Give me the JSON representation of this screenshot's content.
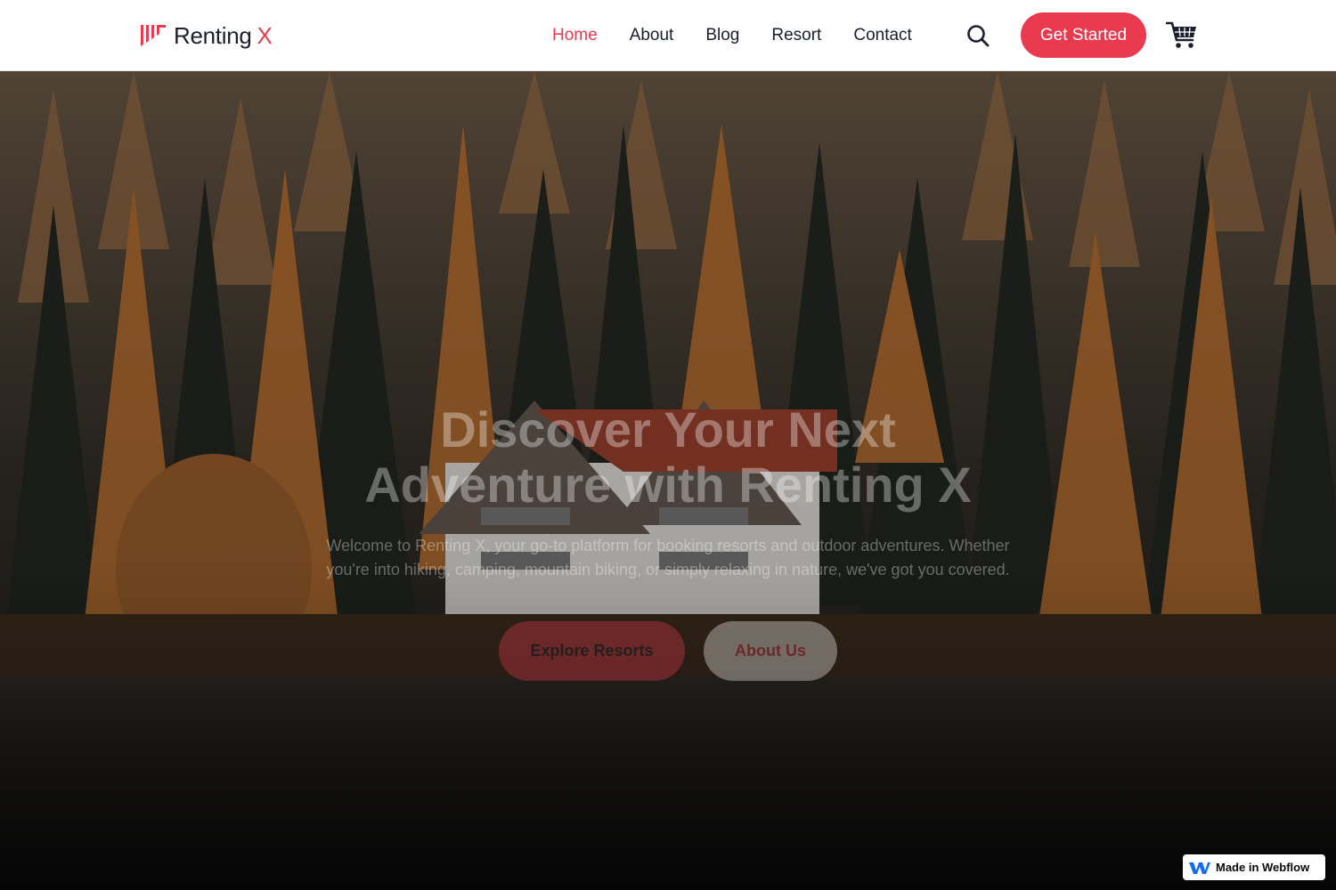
{
  "brand": {
    "name": "Renting",
    "accent": "X",
    "colors": {
      "accent": "#ea3a50",
      "text": "#1b1f2e"
    }
  },
  "nav": {
    "links": [
      {
        "label": "Home",
        "active": true
      },
      {
        "label": "About",
        "active": false
      },
      {
        "label": "Blog",
        "active": false
      },
      {
        "label": "Resort",
        "active": false
      },
      {
        "label": "Contact",
        "active": false
      }
    ],
    "search_icon": "search-icon",
    "cta_label": "Get Started",
    "cart_icon": "cart-icon"
  },
  "hero": {
    "title_line1": "Discover Your Next",
    "title_line2": "Adventure with Renting X",
    "text": "Welcome to Renting X, your go-to platform for booking resorts and outdoor adventures. Whether you're into hiking, camping, mountain biking, or simply relaxing in nature, we've got you covered.",
    "primary_button": "Explore Resorts",
    "secondary_button": "About Us",
    "background": "lakeside house in autumn forest"
  },
  "badge": {
    "label": "Made in Webflow",
    "icon": "webflow-logo-icon"
  }
}
